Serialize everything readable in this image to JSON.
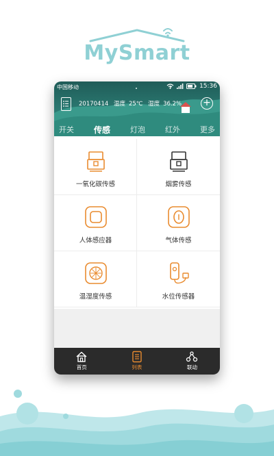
{
  "brand": {
    "title": "MySmart"
  },
  "status": {
    "carrier": "中国移动",
    "time": "15:36"
  },
  "info": {
    "date": "20170414",
    "temp_label": "温度",
    "temp_value": "25℃",
    "humidity_label": "湿度",
    "humidity_value": "36.2%"
  },
  "tabs": [
    {
      "label": "开关"
    },
    {
      "label": "传感",
      "active": true
    },
    {
      "label": "灯泡"
    },
    {
      "label": "红外"
    },
    {
      "label": "更多"
    }
  ],
  "sensors": [
    {
      "label": "一氧化碳传感",
      "icon": "co-sensor-icon"
    },
    {
      "label": "烟雾传感",
      "icon": "smoke-sensor-icon"
    },
    {
      "label": "人体感应器",
      "icon": "motion-sensor-icon"
    },
    {
      "label": "气体传感",
      "icon": "gas-sensor-icon"
    },
    {
      "label": "温湿度传感",
      "icon": "temp-humidity-sensor-icon"
    },
    {
      "label": "水位传感器",
      "icon": "water-level-sensor-icon"
    }
  ],
  "nav": [
    {
      "label": "首页",
      "icon": "home-icon"
    },
    {
      "label": "列表",
      "icon": "list-icon",
      "active": true
    },
    {
      "label": "联动",
      "icon": "linkage-icon"
    }
  ],
  "colors": {
    "brand": "#8fd0d4",
    "header": "#2c7b73",
    "accent": "#e98b2f",
    "nav_bg": "#2b2b2b"
  }
}
